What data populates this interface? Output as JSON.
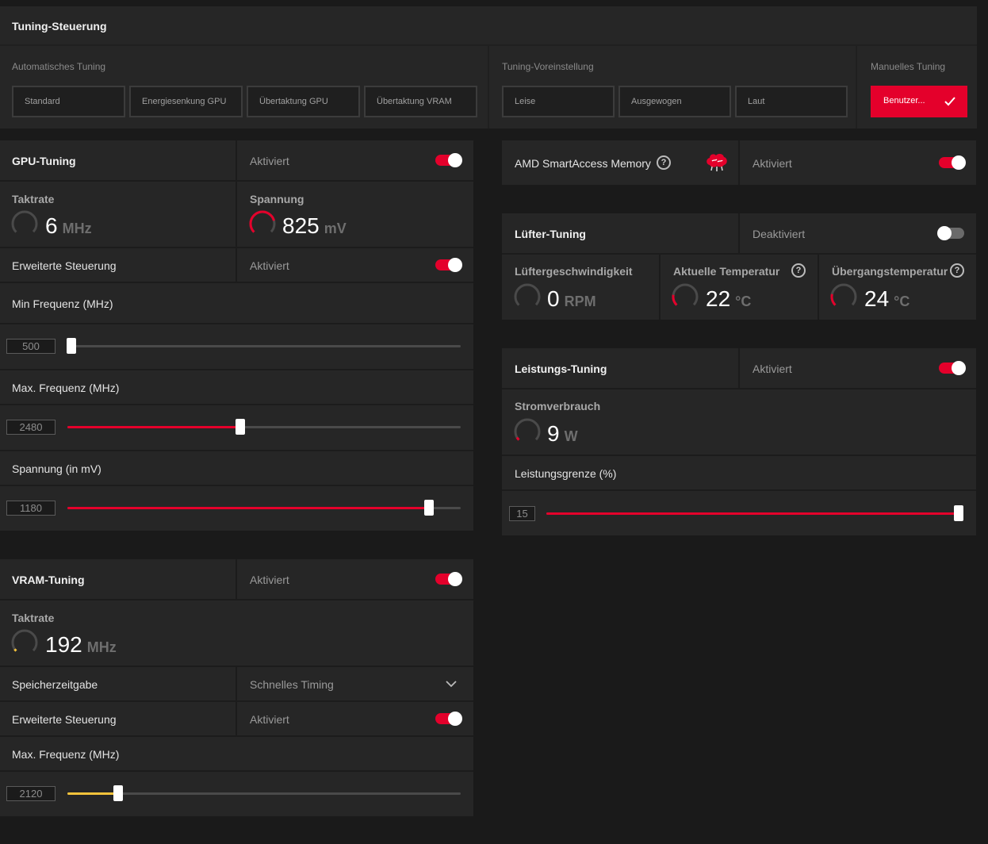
{
  "colors": {
    "accent": "#e4002b",
    "vram_accent": "#f5c33b",
    "background": "#1a1a1a",
    "panel": "#242424"
  },
  "tuning": {
    "title": "Tuning-Steuerung",
    "auto_label": "Automatisches Tuning",
    "auto_buttons": [
      "Standard",
      "Energiesenkung GPU",
      "Übertaktung GPU",
      "Übertaktung VRAM"
    ],
    "preset_label": "Tuning-Voreinstellung",
    "preset_buttons": [
      "Leise",
      "Ausgewogen",
      "Laut"
    ],
    "manual_label": "Manuelles Tuning",
    "manual_button": "Benutzer..."
  },
  "gpu": {
    "title": "GPU-Tuning",
    "state": "Aktiviert",
    "clock_title": "Taktrate",
    "clock_value": "6",
    "clock_unit": "MHz",
    "voltage_title": "Spannung",
    "voltage_value": "825",
    "voltage_unit": "mV",
    "adv_label": "Erweiterte Steuerung",
    "adv_state": "Aktiviert",
    "min_freq_label": "Min Frequenz (MHz)",
    "min_freq_value": "500",
    "min_freq_fraction": 0.0,
    "max_freq_label": "Max. Frequenz (MHz)",
    "max_freq_value": "2480",
    "max_freq_fraction": 0.44,
    "voltage_label": "Spannung (in mV)",
    "voltage_slider_value": "1180",
    "voltage_fraction": 0.92
  },
  "vram": {
    "title": "VRAM-Tuning",
    "state": "Aktiviert",
    "clock_title": "Taktrate",
    "clock_value": "192",
    "clock_unit": "MHz",
    "timing_label": "Speicherzeitgabe",
    "timing_value": "Schnelles Timing",
    "adv_label": "Erweiterte Steuerung",
    "adv_state": "Aktiviert",
    "max_freq_label": "Max. Frequenz (MHz)",
    "max_freq_value": "2120",
    "max_freq_fraction": 0.13
  },
  "sam": {
    "title": "AMD SmartAccess Memory",
    "state": "Aktiviert"
  },
  "fan": {
    "title": "Lüfter-Tuning",
    "state": "Deaktiviert",
    "speed_title": "Lüftergeschwindigkeit",
    "speed_value": "0",
    "speed_unit": "RPM",
    "temp_title": "Aktuelle Temperatur",
    "temp_value": "22",
    "temp_unit": "°C",
    "junction_title": "Übergangstemperatur",
    "junction_value": "24",
    "junction_unit": "°C"
  },
  "power": {
    "title": "Leistungs-Tuning",
    "state": "Aktiviert",
    "usage_title": "Stromverbrauch",
    "usage_value": "9",
    "usage_unit": "W",
    "limit_label": "Leistungsgrenze (%)",
    "limit_value": "15",
    "limit_fraction": 1.0
  }
}
